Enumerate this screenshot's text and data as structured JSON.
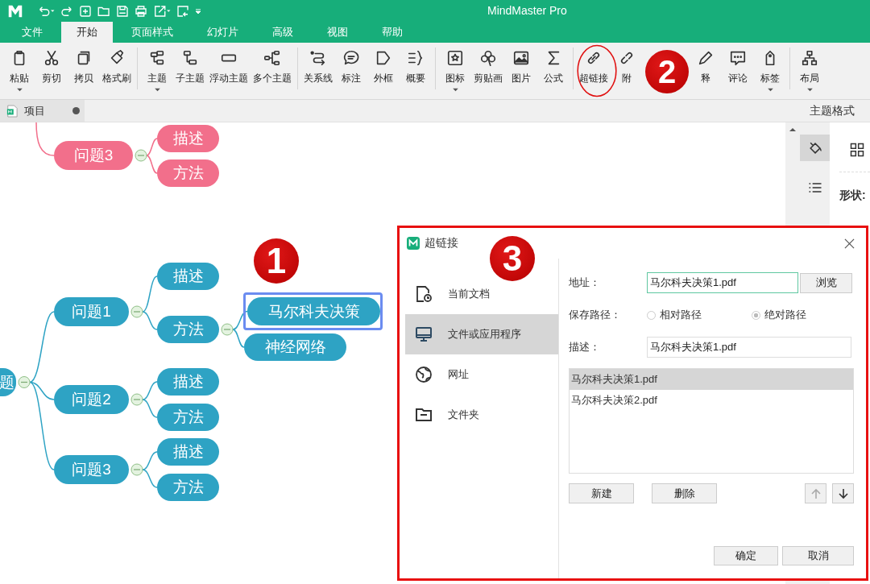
{
  "app": {
    "title": "MindMaster Pro"
  },
  "menu_tabs": [
    {
      "label": "文件",
      "selected": false
    },
    {
      "label": "开始",
      "selected": true
    },
    {
      "label": "页面样式",
      "selected": false
    },
    {
      "label": "幻灯片",
      "selected": false
    },
    {
      "label": "高级",
      "selected": false
    },
    {
      "label": "视图",
      "selected": false
    },
    {
      "label": "帮助",
      "selected": false
    }
  ],
  "toolbar": {
    "groups": [
      [
        {
          "label": "粘贴",
          "has_menu": true,
          "circled": false
        },
        {
          "label": "剪切",
          "has_menu": false,
          "circled": false
        },
        {
          "label": "拷贝",
          "has_menu": false,
          "circled": false
        },
        {
          "label": "格式刷",
          "has_menu": false,
          "circled": false
        }
      ],
      [
        {
          "label": "主题",
          "has_menu": true,
          "circled": false
        },
        {
          "label": "子主题",
          "has_menu": false,
          "circled": false
        },
        {
          "label": "浮动主题",
          "has_menu": false,
          "circled": false
        },
        {
          "label": "多个主题",
          "has_menu": false,
          "circled": false
        }
      ],
      [
        {
          "label": "关系线",
          "has_menu": false,
          "circled": false
        },
        {
          "label": "标注",
          "has_menu": false,
          "circled": false
        },
        {
          "label": "外框",
          "has_menu": false,
          "circled": false
        },
        {
          "label": "概要",
          "has_menu": false,
          "circled": false
        }
      ],
      [
        {
          "label": "图标",
          "has_menu": true,
          "circled": false
        },
        {
          "label": "剪贴画",
          "has_menu": false,
          "circled": false
        },
        {
          "label": "图片",
          "has_menu": false,
          "circled": false
        },
        {
          "label": "公式",
          "has_menu": false,
          "circled": false
        }
      ],
      [
        {
          "label": "超链接",
          "has_menu": false,
          "circled": true
        },
        {
          "label": "附",
          "has_menu": false,
          "circled": false
        },
        {
          "label": "释",
          "has_menu": false,
          "circled": false
        },
        {
          "label": "评论",
          "has_menu": false,
          "circled": false
        },
        {
          "label": "标签",
          "has_menu": true,
          "circled": false
        }
      ],
      [
        {
          "label": "布局",
          "has_menu": true,
          "circled": false
        }
      ]
    ]
  },
  "document_tab": {
    "label": "项目",
    "modified": true
  },
  "side_panel": {
    "title": "主题格式",
    "shape_label": "形状:"
  },
  "mind_map": {
    "floating_branch": {
      "text": "问题3",
      "color": "#f26f8b",
      "children": [
        {
          "text": "描述",
          "highlighted": false
        },
        {
          "text": "方法",
          "highlighted": false
        }
      ]
    },
    "root": {
      "text": "题",
      "color": "#2ea3c4",
      "children": [
        {
          "text": "问题1",
          "children": [
            {
              "text": "描述",
              "highlighted": false
            },
            {
              "text": "方法",
              "highlighted": false,
              "children": [
                {
                  "text": "马尔科夫决策",
                  "highlighted": true
                },
                {
                  "text": "神经网络",
                  "highlighted": false
                }
              ]
            }
          ]
        },
        {
          "text": "问题2",
          "children": [
            {
              "text": "描述",
              "highlighted": false
            },
            {
              "text": "方法",
              "highlighted": false
            }
          ]
        },
        {
          "text": "问题3",
          "children": [
            {
              "text": "描述",
              "highlighted": false
            },
            {
              "text": "方法",
              "highlighted": false
            }
          ]
        }
      ]
    }
  },
  "dialog": {
    "title": "超链接",
    "annotated": true,
    "nav": [
      {
        "label": "当前文档",
        "selected": false
      },
      {
        "label": "文件或应用程序",
        "selected": true
      },
      {
        "label": "网址",
        "selected": false
      },
      {
        "label": "文件夹",
        "selected": false
      }
    ],
    "address_label": "地址：",
    "address": "马尔科夫决策1.pdf",
    "browse": "浏览",
    "save_path_label": "保存路径：",
    "path_options": [
      {
        "label": "相对路径",
        "selected": false
      },
      {
        "label": "绝对路径",
        "selected": true
      }
    ],
    "description_label": "描述：",
    "description": "马尔科夫决策1.pdf",
    "files": [
      {
        "label": "马尔科夫决策1.pdf",
        "selected": true
      },
      {
        "label": "马尔科夫决策2.pdf",
        "selected": false
      }
    ],
    "new": "新建",
    "delete": "删除",
    "move_up_disabled": true,
    "move_down_disabled": false,
    "ok": "确定",
    "cancel": "取消"
  },
  "annotations": [
    {
      "label": "1"
    },
    {
      "label": "2"
    },
    {
      "label": "3"
    }
  ]
}
